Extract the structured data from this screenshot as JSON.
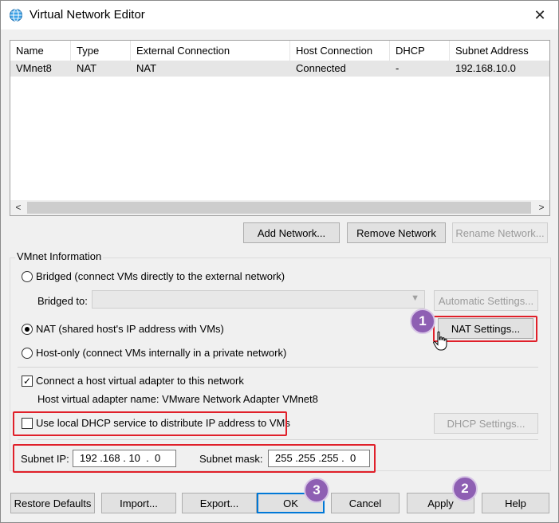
{
  "window": {
    "title": "Virtual Network Editor",
    "close_glyph": "✕"
  },
  "table": {
    "headers": [
      "Name",
      "Type",
      "External Connection",
      "Host Connection",
      "DHCP",
      "Subnet Address"
    ],
    "rows": [
      [
        "VMnet8",
        "NAT",
        "NAT",
        "Connected",
        "-",
        "192.168.10.0"
      ]
    ],
    "scroll_left": "<",
    "scroll_right": ">"
  },
  "network_buttons": {
    "add": "Add Network...",
    "remove": "Remove Network",
    "rename": "Rename Network..."
  },
  "vmnet_info": {
    "group_title": "VMnet Information",
    "bridged_label": "Bridged (connect VMs directly to the external network)",
    "bridged_to_label": "Bridged to:",
    "bridged_to_value": "",
    "automatic_settings": "Automatic Settings...",
    "nat_label": "NAT (shared host's IP address with VMs)",
    "nat_settings": "NAT Settings...",
    "hostonly_label": "Host-only (connect VMs internally in a private network)",
    "selected_mode": "nat",
    "connect_adapter_label": "Connect a host virtual adapter to this network",
    "connect_adapter_checked": true,
    "adapter_name_label": "Host virtual adapter name: VMware Network Adapter VMnet8",
    "dhcp_label": "Use local DHCP service to distribute IP address to VMs",
    "dhcp_checked": false,
    "dhcp_settings": "DHCP Settings...",
    "subnet_ip_label": "Subnet IP:",
    "subnet_ip": "192 .168 . 10  .  0",
    "subnet_mask_label": "Subnet mask:",
    "subnet_mask": "255 .255 .255 .  0"
  },
  "footer_buttons": {
    "restore": "Restore Defaults",
    "import": "Import...",
    "export": "Export...",
    "ok": "OK",
    "cancel": "Cancel",
    "apply": "Apply",
    "help": "Help"
  },
  "annotations": {
    "badge_1": "1",
    "badge_2": "2",
    "badge_3": "3",
    "highlight_color": "#e0202a",
    "badge_color": "#8e5fb3"
  },
  "icons": {
    "app": "globe-network-icon",
    "close": "close-icon",
    "cursor": "hand-pointer-icon"
  }
}
